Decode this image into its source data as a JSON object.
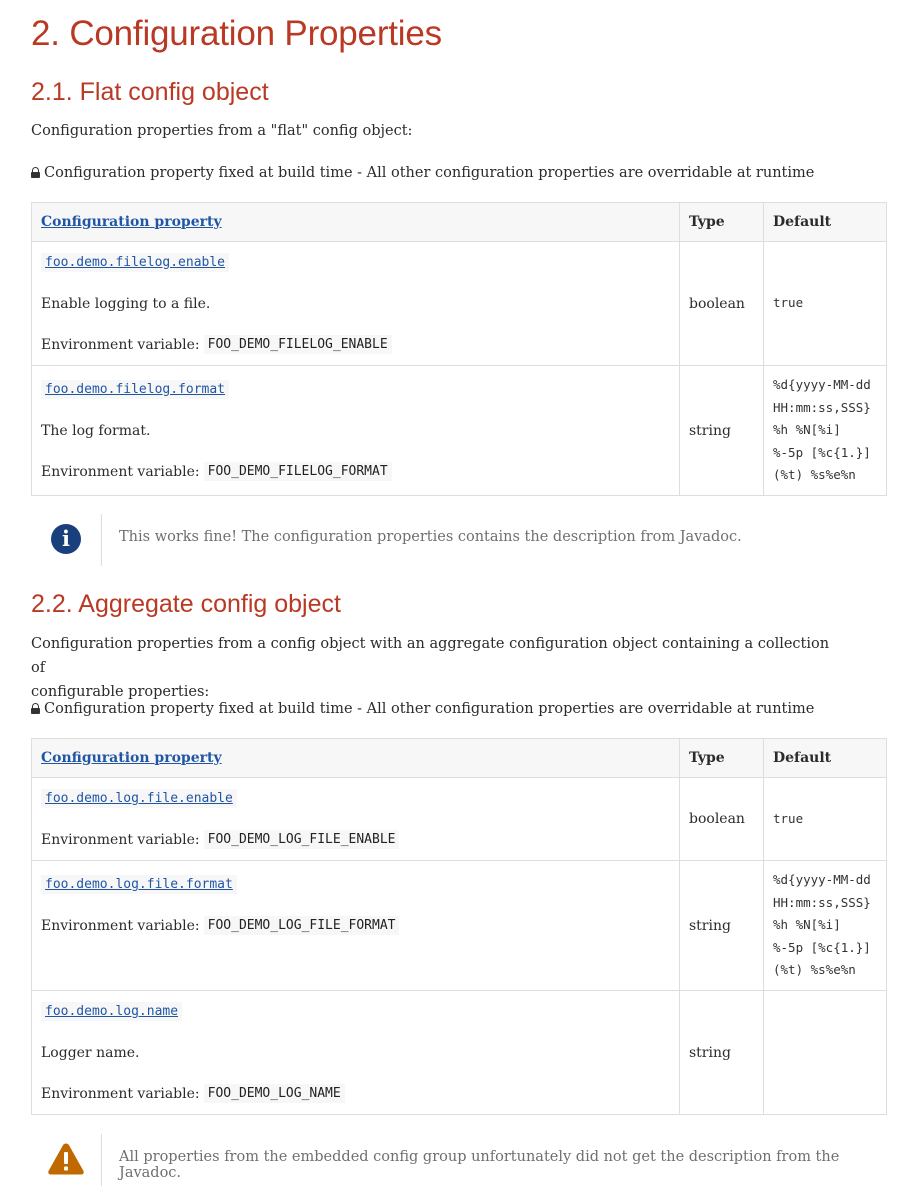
{
  "title": "2. Configuration Properties",
  "section1": {
    "heading": "2.1. Flat config object",
    "intro": "Configuration properties from a \"flat\" config object:",
    "legend": "Configuration property fixed at build time - All other configuration properties are overridable at runtime",
    "table": {
      "headers": [
        "Configuration property",
        "Type",
        "Default"
      ],
      "rows": [
        {
          "property": "foo.demo.filelog.enable",
          "description": "Enable logging to a file.",
          "env_label": "Environment variable:",
          "env": "FOO_DEMO_FILELOG_ENABLE",
          "type": "boolean",
          "default": [
            "true"
          ]
        },
        {
          "property": "foo.demo.filelog.format",
          "description": "The log format.",
          "env_label": "Environment variable:",
          "env": "FOO_DEMO_FILELOG_FORMAT",
          "type": "string",
          "default": [
            "%d{yyyy-MM-dd",
            "HH:mm:ss,SSS}",
            "%h %N[%i]",
            "%-5p [%c{1.}]",
            "(%t) %s%e%n"
          ]
        }
      ]
    },
    "note": "This works fine! The configuration properties contains the description from Javadoc."
  },
  "section2": {
    "heading": "2.2. Aggregate config object",
    "intro_line1": "Configuration properties from a config object with an aggregate configuration object containing a collection of",
    "intro_line2": "configurable properties:",
    "legend": "Configuration property fixed at build time - All other configuration properties are overridable at runtime",
    "table": {
      "headers": [
        "Configuration property",
        "Type",
        "Default"
      ],
      "rows": [
        {
          "property": "foo.demo.log.file.enable",
          "env_label": "Environment variable:",
          "env": "FOO_DEMO_LOG_FILE_ENABLE",
          "type": "boolean",
          "default": [
            "true"
          ]
        },
        {
          "property": "foo.demo.log.file.format",
          "env_label": "Environment variable:",
          "env": "FOO_DEMO_LOG_FILE_FORMAT",
          "type": "string",
          "default": [
            "%d{yyyy-MM-dd",
            "HH:mm:ss,SSS}",
            "%h %N[%i]",
            "%-5p [%c{1.}]",
            "(%t) %s%e%n"
          ]
        },
        {
          "property": "foo.demo.log.name",
          "description": "Logger name.",
          "env_label": "Environment variable:",
          "env": "FOO_DEMO_LOG_NAME",
          "type": "string",
          "default": []
        }
      ]
    },
    "warning": "All properties from the embedded config group unfortunately did not get the description from the Javadoc."
  },
  "icons": {
    "lock": "lock-icon",
    "info": "info-icon",
    "warning": "warning-icon"
  },
  "colors": {
    "heading": "#ba3925",
    "link": "#2156a5",
    "info_icon": "#19407c",
    "warning_icon": "#bf6900"
  }
}
